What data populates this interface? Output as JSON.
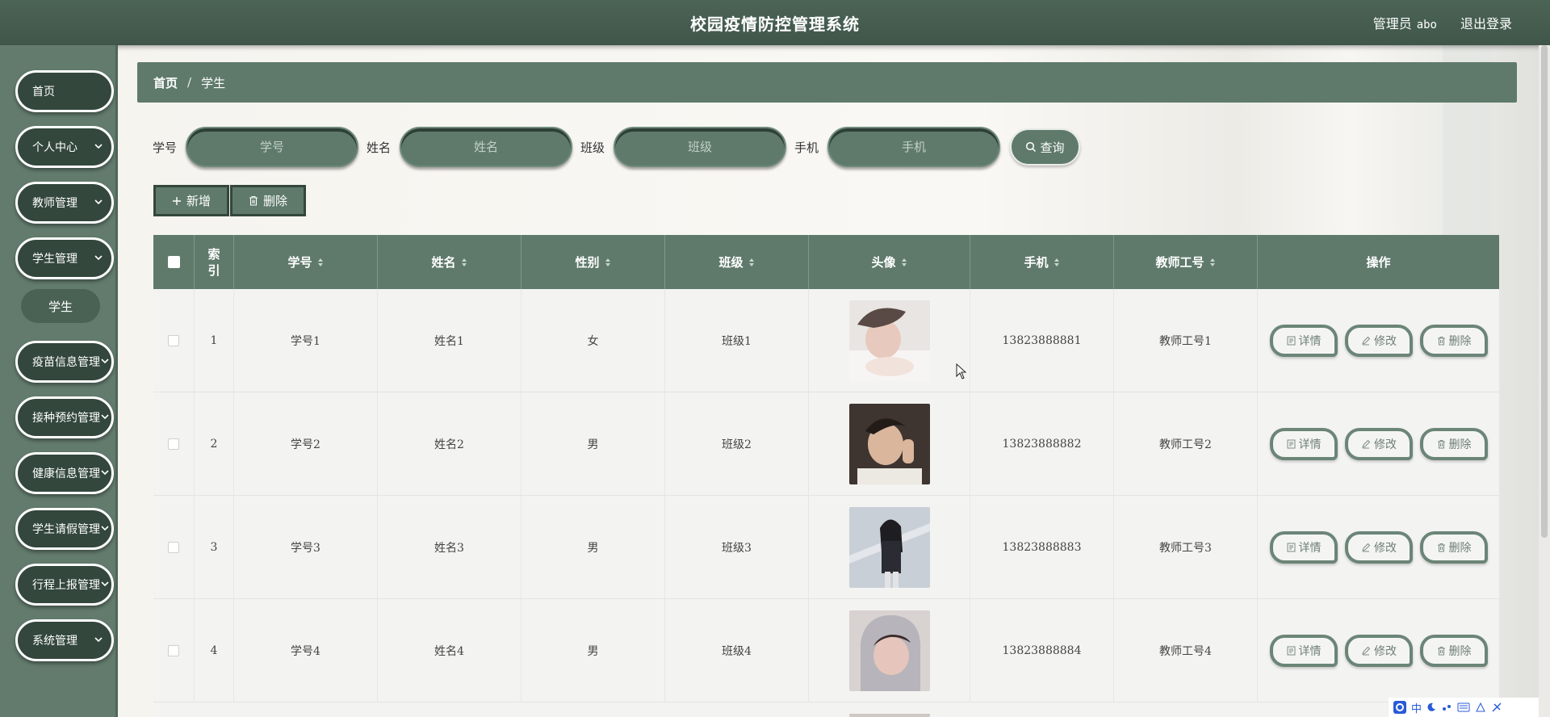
{
  "header": {
    "title": "校园疫情防控管理系统",
    "user_role": "管理员",
    "username": "abo",
    "logout": "退出登录"
  },
  "sidebar": {
    "items": [
      {
        "label": "首页",
        "has_chevron": false
      },
      {
        "label": "个人中心",
        "has_chevron": true
      },
      {
        "label": "教师管理",
        "has_chevron": true
      },
      {
        "label": "学生管理",
        "has_chevron": true
      },
      {
        "label": "疫苗信息管理",
        "has_chevron": true
      },
      {
        "label": "接种预约管理",
        "has_chevron": true
      },
      {
        "label": "健康信息管理",
        "has_chevron": true
      },
      {
        "label": "学生请假管理",
        "has_chevron": true
      },
      {
        "label": "行程上报管理",
        "has_chevron": true
      },
      {
        "label": "系统管理",
        "has_chevron": true
      }
    ],
    "active_sub": "学生"
  },
  "breadcrumb": {
    "home": "首页",
    "separator": "/",
    "current": "学生"
  },
  "search": {
    "fields": [
      {
        "label": "学号",
        "placeholder": "学号"
      },
      {
        "label": "姓名",
        "placeholder": "姓名"
      },
      {
        "label": "班级",
        "placeholder": "班级"
      },
      {
        "label": "手机",
        "placeholder": "手机"
      }
    ],
    "query_label": "查询"
  },
  "actions": {
    "add_label": "新增",
    "delete_label": "删除"
  },
  "table": {
    "columns": [
      "索引",
      "学号",
      "姓名",
      "性别",
      "班级",
      "头像",
      "手机",
      "教师工号",
      "操作"
    ],
    "rows": [
      {
        "index": "1",
        "student_no": "学号1",
        "name": "姓名1",
        "gender": "女",
        "class": "班级1",
        "phone": "13823888881",
        "teacher_no": "教师工号1"
      },
      {
        "index": "2",
        "student_no": "学号2",
        "name": "姓名2",
        "gender": "男",
        "class": "班级2",
        "phone": "13823888882",
        "teacher_no": "教师工号2"
      },
      {
        "index": "3",
        "student_no": "学号3",
        "name": "姓名3",
        "gender": "男",
        "class": "班级3",
        "phone": "13823888883",
        "teacher_no": "教师工号3"
      },
      {
        "index": "4",
        "student_no": "学号4",
        "name": "姓名4",
        "gender": "男",
        "class": "班级4",
        "phone": "13823888884",
        "teacher_no": "教师工号4"
      }
    ],
    "row_actions": {
      "detail": "详情",
      "edit": "修改",
      "delete": "删除"
    }
  },
  "ime": {
    "label": "中"
  },
  "colors": {
    "header": "#3f5649",
    "sidebar": "#627b6d",
    "accent": "#5f7a6b",
    "menu_pill": "#33473c"
  }
}
